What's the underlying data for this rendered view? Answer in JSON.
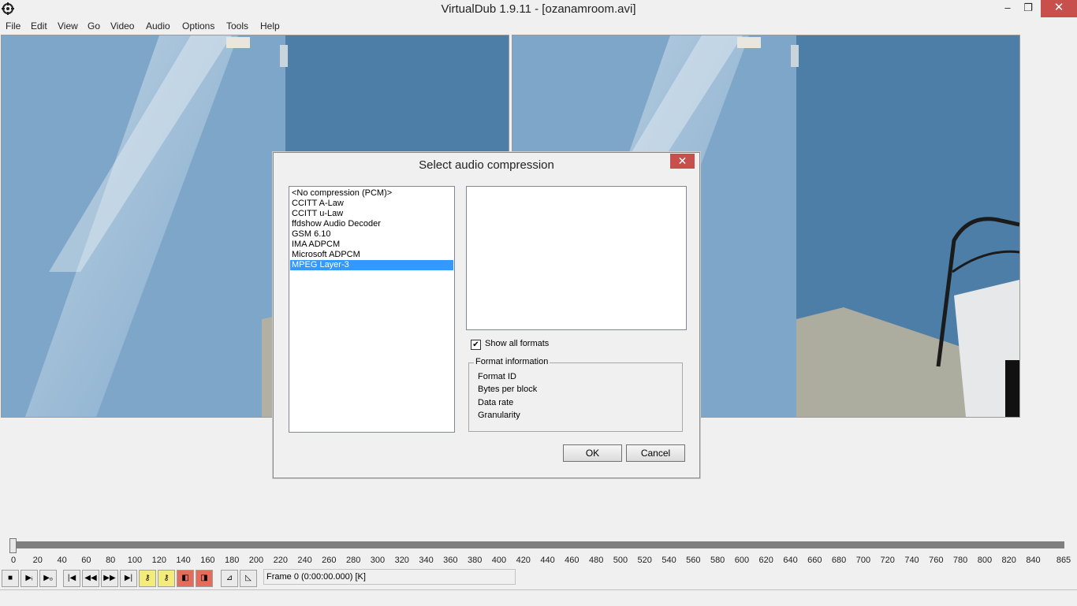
{
  "window": {
    "title": "VirtualDub 1.9.11 - [ozanamroom.avi]",
    "minimize": "–",
    "maximize": "❐",
    "close": "✕"
  },
  "menu": [
    "File",
    "Edit",
    "View",
    "Go",
    "Video",
    "Audio",
    "Options",
    "Tools",
    "Help"
  ],
  "dialog": {
    "title": "Select audio compression",
    "close": "✕",
    "codecs": [
      "<No compression (PCM)>",
      "CCITT A-Law",
      "CCITT u-Law",
      "ffdshow Audio Decoder",
      "GSM 6.10",
      "IMA ADPCM",
      "Microsoft ADPCM",
      "MPEG Layer-3"
    ],
    "selected_codec": "MPEG Layer-3",
    "show_all_formats": {
      "label": "Show all formats",
      "checked": true,
      "mark": "✔"
    },
    "format_info": {
      "legend": "Format information",
      "rows": [
        "Format ID",
        "Bytes per block",
        "Data rate",
        "Granularity"
      ]
    },
    "ok": "OK",
    "cancel": "Cancel"
  },
  "timeline": {
    "ticks": [
      "0",
      "20",
      "40",
      "60",
      "80",
      "100",
      "120",
      "140",
      "160",
      "180",
      "200",
      "220",
      "240",
      "260",
      "280",
      "300",
      "320",
      "340",
      "360",
      "380",
      "400",
      "420",
      "440",
      "460",
      "480",
      "500",
      "520",
      "540",
      "560",
      "580",
      "600",
      "620",
      "640",
      "660",
      "680",
      "700",
      "720",
      "740",
      "760",
      "780",
      "800",
      "820",
      "840",
      "865"
    ],
    "position": 0
  },
  "toolbar": {
    "frame_text": "Frame 0 (0:00:00.000) [K]",
    "buttons": [
      "stop",
      "play-input",
      "play-output",
      "start",
      "prev-frame",
      "next-frame",
      "end",
      "prev-keyframe",
      "next-keyframe",
      "scene-back",
      "scene-forward",
      "mark-in",
      "mark-out"
    ]
  },
  "colors": {
    "selection": "#3399ff",
    "close_red": "#c7504c",
    "wall_blue": "#4e7ea8"
  }
}
